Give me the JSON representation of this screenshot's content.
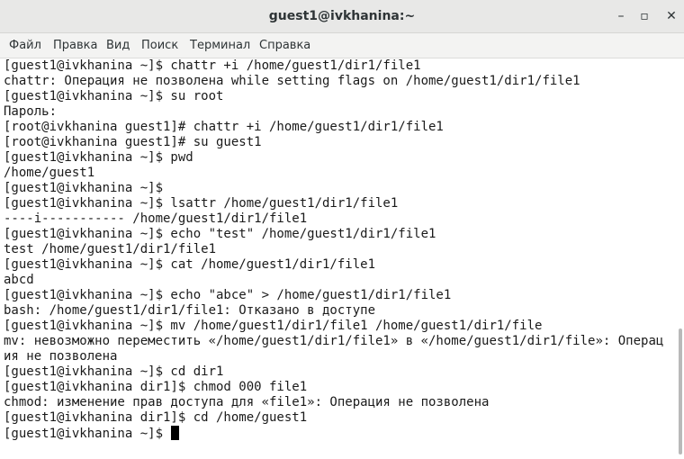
{
  "window": {
    "title": "guest1@ivkhanina:~",
    "minimize_glyph": "–",
    "maximize_glyph": "▫",
    "close_glyph": "✕"
  },
  "menu": [
    {
      "label": "Файл"
    },
    {
      "label": "Правка"
    },
    {
      "label": "Вид"
    },
    {
      "label": "Поиск"
    },
    {
      "label": "Терминал"
    },
    {
      "label": "Справка"
    }
  ],
  "terminal": {
    "lines": [
      "[guest1@ivkhanina ~]$ chattr +i /home/guest1/dir1/file1",
      "chattr: Операция не позволена while setting flags on /home/guest1/dir1/file1",
      "[guest1@ivkhanina ~]$ su root",
      "Пароль:",
      "[root@ivkhanina guest1]# chattr +i /home/guest1/dir1/file1",
      "[root@ivkhanina guest1]# su guest1",
      "[guest1@ivkhanina ~]$ pwd",
      "/home/guest1",
      "[guest1@ivkhanina ~]$",
      "[guest1@ivkhanina ~]$ lsattr /home/guest1/dir1/file1",
      "----i----------- /home/guest1/dir1/file1",
      "[guest1@ivkhanina ~]$ echo \"test\" /home/guest1/dir1/file1",
      "test /home/guest1/dir1/file1",
      "[guest1@ivkhanina ~]$ cat /home/guest1/dir1/file1",
      "abcd",
      "[guest1@ivkhanina ~]$ echo \"abce\" > /home/guest1/dir1/file1",
      "bash: /home/guest1/dir1/file1: Отказано в доступе",
      "[guest1@ivkhanina ~]$ mv /home/guest1/dir1/file1 /home/guest1/dir1/file",
      "mv: невозможно переместить «/home/guest1/dir1/file1» в «/home/guest1/dir1/file»: Операц",
      "ия не позволена",
      "[guest1@ivkhanina ~]$ cd dir1",
      "[guest1@ivkhanina dir1]$ chmod 000 file1",
      "chmod: изменение прав доступа для «file1»: Операция не позволена",
      "[guest1@ivkhanina dir1]$ cd /home/guest1"
    ],
    "prompt": "[guest1@ivkhanina ~]$ "
  }
}
